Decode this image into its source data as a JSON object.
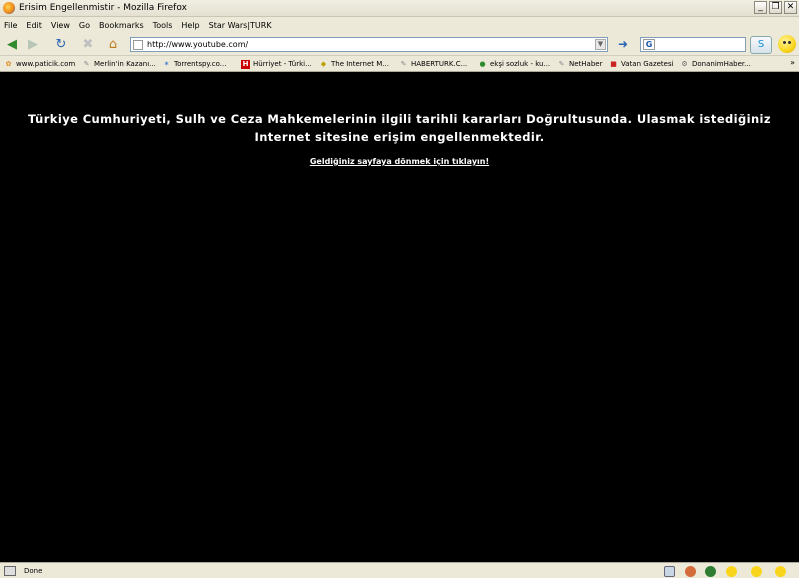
{
  "window": {
    "title": "Erisim Engellenmistir - Mozilla Firefox",
    "min_label": "_",
    "max_label": "❐",
    "close_label": "✕"
  },
  "menu": {
    "items": [
      "File",
      "Edit",
      "View",
      "Go",
      "Bookmarks",
      "Tools",
      "Help",
      "Star Wars|TURK"
    ]
  },
  "nav": {
    "url": "http://www.youtube.com/",
    "search_value": ""
  },
  "bookmarks": {
    "items": [
      {
        "label": "www.paticik.com",
        "icon": "paw-icon",
        "color": "#e08a1a"
      },
      {
        "label": "Merlin'in Kazanı...",
        "icon": "page-icon",
        "color": "#888888"
      },
      {
        "label": "Torrentspy.co...",
        "icon": "star-icon",
        "color": "#3a7bd5"
      },
      {
        "label": "Hürriyet - Türki...",
        "icon": "h-icon",
        "color": "#cc0000"
      },
      {
        "label": "The Internet M...",
        "icon": "ia-icon",
        "color": "#b8a000"
      },
      {
        "label": "HABERTURK.C...",
        "icon": "page-icon",
        "color": "#888888"
      },
      {
        "label": "ekşi sozluk - ku...",
        "icon": "drop-icon",
        "color": "#2e8b2e"
      },
      {
        "label": "NetHaber",
        "icon": "page-icon",
        "color": "#888888"
      },
      {
        "label": "Vatan Gazetesi",
        "icon": "vatan-icon",
        "color": "#cc2222"
      },
      {
        "label": "DonanimHaber...",
        "icon": "gear-icon",
        "color": "#666666"
      }
    ],
    "more_label": "»"
  },
  "content": {
    "message": "Türkiye Cumhuriyeti, Sulh ve Ceza Mahkemelerinin ilgili tarihli kararları Doğrultusunda. Ulasmak istediğiniz Internet sitesine erişim engellenmektedir.",
    "back_link": "Geldiğiniz sayfaya dönmek için tıklayın!"
  },
  "status": {
    "text": "Done"
  },
  "colors": {
    "page_background": "#000000",
    "message_text": "#ffffff",
    "chrome": "#ece9d8"
  }
}
